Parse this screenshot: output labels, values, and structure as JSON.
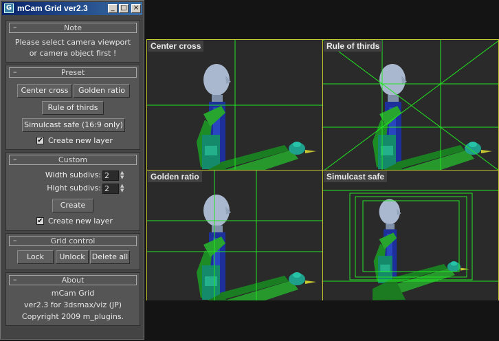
{
  "window": {
    "title": "mCam Grid ver2.3",
    "icon": "app-icon"
  },
  "note": {
    "header": "Note",
    "line1": "Please select camera viewport",
    "line2": "or camera object first !"
  },
  "preset": {
    "header": "Preset",
    "center_cross": "Center cross",
    "golden_ratio": "Golden ratio",
    "rule_of_thirds": "Rule of thirds",
    "simulcast": "Simulcast safe (16:9 only)",
    "create_layer": "Create new layer",
    "create_layer_checked": true
  },
  "custom": {
    "header": "Custom",
    "width_label": "Width subdivs:",
    "width_value": "2",
    "height_label": "Hight subdivs:",
    "height_value": "2",
    "create": "Create",
    "create_layer": "Create new layer",
    "create_layer_checked": true
  },
  "grid_control": {
    "header": "Grid control",
    "lock": "Lock",
    "unlock": "Unlock",
    "delete_all": "Delete all"
  },
  "about": {
    "header": "About",
    "line1": "mCam Grid",
    "line2": "ver2.3 for 3dsmax/viz (JP)",
    "line3": "Copyright 2009 m_plugins."
  },
  "viewports": {
    "center_cross": "Center cross",
    "rule_of_thirds": "Rule of thirds",
    "golden_ratio": "Golden ratio",
    "simulcast": "Simulcast safe"
  },
  "colors": {
    "grid_line": "#22e622",
    "viewport_border": "#c8c830",
    "panel_bg": "#555555"
  }
}
